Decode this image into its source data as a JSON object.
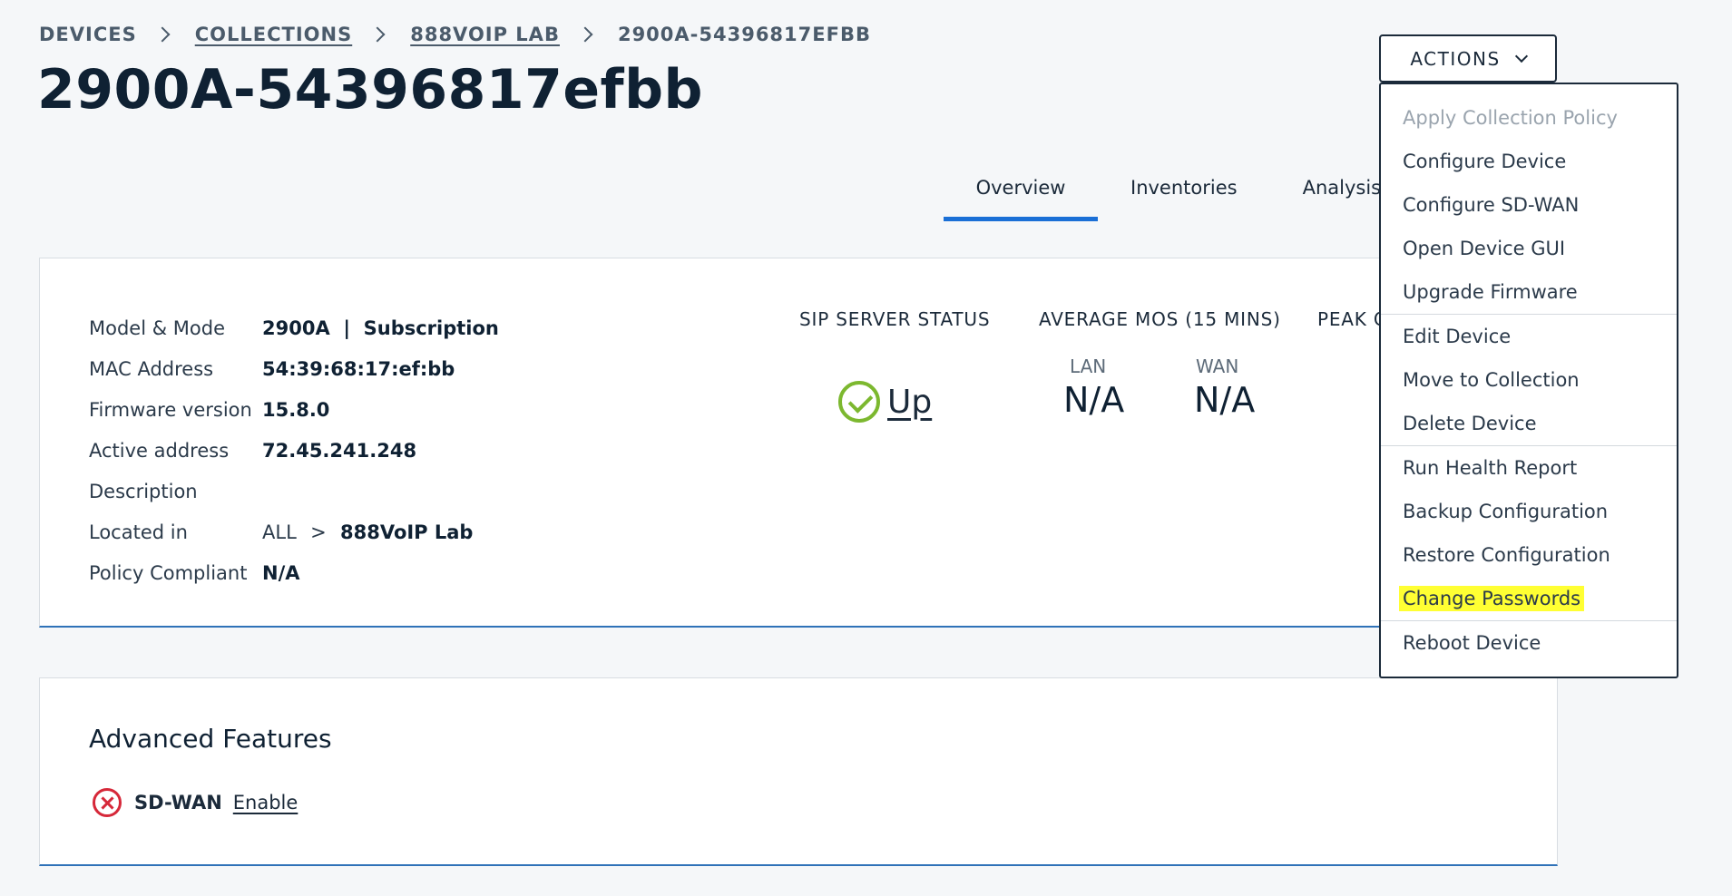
{
  "breadcrumb": {
    "devices": "DEVICES",
    "collections": "COLLECTIONS",
    "lab": "888VOIP LAB",
    "current": "2900A-54396817EFBB"
  },
  "page_title": "2900A-54396817efbb",
  "actions": {
    "label": "ACTIONS",
    "menu": {
      "group1": {
        "apply_policy": "Apply Collection Policy",
        "configure_device": "Configure Device",
        "configure_sdwan": "Configure SD-WAN",
        "open_gui": "Open Device GUI",
        "upgrade_firmware": "Upgrade Firmware"
      },
      "group2": {
        "edit_device": "Edit Device",
        "move_collection": "Move to Collection",
        "delete_device": "Delete Device"
      },
      "group3": {
        "health_report": "Run Health Report",
        "backup_config": "Backup Configuration",
        "restore_config": "Restore Configuration",
        "change_passwords": "Change Passwords"
      },
      "group4": {
        "reboot": "Reboot Device"
      }
    }
  },
  "tabs": {
    "overview": "Overview",
    "inventories": "Inventories",
    "analysis": "Analysis"
  },
  "device_info": {
    "model_label": "Model & Mode",
    "model_value": "2900A  |  Subscription",
    "mac_label": "MAC Address",
    "mac_value": "54:39:68:17:ef:bb",
    "firmware_label": "Firmware version",
    "firmware_value": "15.8.0",
    "address_label": "Active address",
    "address_value": "72.45.241.248",
    "description_label": "Description",
    "description_value": "",
    "located_label": "Located in",
    "located_root": "ALL",
    "located_sep": ">",
    "located_value": "888VoIP Lab",
    "policy_label": "Policy Compliant",
    "policy_value": "N/A"
  },
  "status": {
    "sip_head": "SIP SERVER STATUS",
    "sip_value": "Up",
    "mos_head": "AVERAGE MOS (15 MINS)",
    "lan_label": "LAN",
    "lan_value": "N/A",
    "wan_label": "WAN",
    "wan_value": "N/A",
    "peak_head": "PEAK C"
  },
  "advanced": {
    "title": "Advanced Features",
    "sdwan_label": "SD-WAN",
    "sdwan_link": "Enable"
  },
  "colors": {
    "accent": "#1a6fd6",
    "ok": "#7cb82f",
    "error": "#d62839",
    "highlight": "#ffff33"
  }
}
